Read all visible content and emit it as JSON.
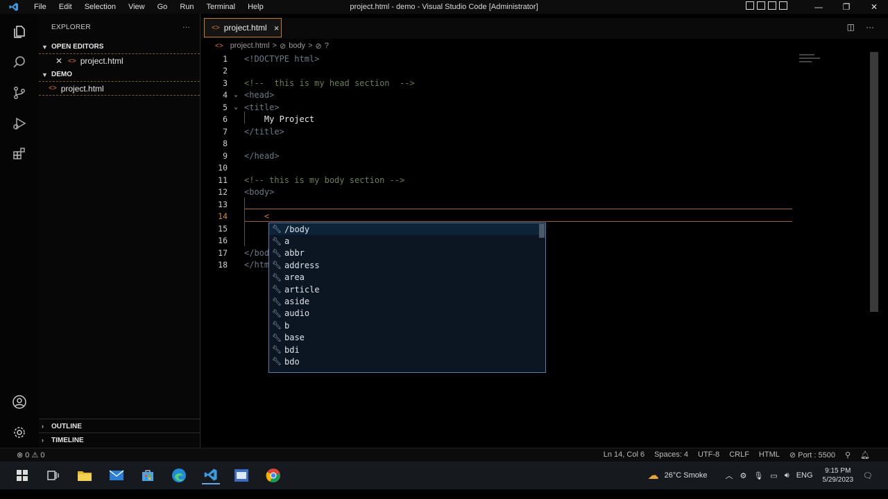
{
  "window": {
    "title": "project.html - demo - Visual Studio Code [Administrator]",
    "menu": [
      "File",
      "Edit",
      "Selection",
      "View",
      "Go",
      "Run",
      "Terminal",
      "Help"
    ]
  },
  "sidebar": {
    "header": "EXPLORER",
    "more": "···",
    "open_editors_label": "OPEN EDITORS",
    "open_editor_file": "project.html",
    "folder_label": "DEMO",
    "folder_file": "project.html",
    "outline_label": "OUTLINE",
    "timeline_label": "TIMELINE"
  },
  "tab": {
    "label": "project.html",
    "close": "×"
  },
  "breadcrumb": {
    "file": "project.html",
    "sep": ">",
    "node1": "body",
    "node2": "?"
  },
  "editor": {
    "lines": [
      {
        "n": "1",
        "code": "<!DOCTYPE html>"
      },
      {
        "n": "2",
        "code": ""
      },
      {
        "n": "3",
        "code": "<!--  this is my head section  -->"
      },
      {
        "n": "4",
        "code": "<head>"
      },
      {
        "n": "5",
        "code": "<title>"
      },
      {
        "n": "6",
        "code": "    My Project"
      },
      {
        "n": "7",
        "code": "</title>"
      },
      {
        "n": "8",
        "code": ""
      },
      {
        "n": "9",
        "code": "</head>"
      },
      {
        "n": "10",
        "code": ""
      },
      {
        "n": "11",
        "code": "<!-- this is my body section -->"
      },
      {
        "n": "12",
        "code": "<body>"
      },
      {
        "n": "13",
        "code": ""
      },
      {
        "n": "14",
        "code": "    <"
      },
      {
        "n": "15",
        "code": ""
      },
      {
        "n": "16",
        "code": ""
      },
      {
        "n": "17",
        "code": "</bod"
      },
      {
        "n": "18",
        "code": "</htm"
      }
    ]
  },
  "suggestions": [
    "/body",
    "a",
    "abbr",
    "address",
    "area",
    "article",
    "aside",
    "audio",
    "b",
    "base",
    "bdi",
    "bdo"
  ],
  "status": {
    "problems": "⊗ 0 ⚠ 0",
    "position": "Ln 14, Col 6",
    "spaces": "Spaces: 4",
    "encoding": "UTF-8",
    "eol": "CRLF",
    "language": "HTML",
    "port": "⊘ Port : 5500"
  },
  "taskbar": {
    "weather": "26°C Smoke",
    "lang": "ENG",
    "time": "9:15 PM",
    "date": "5/29/2023"
  },
  "colors": {
    "accent_orange": "#c57a2b",
    "suggest_border": "#5a7fa8"
  }
}
